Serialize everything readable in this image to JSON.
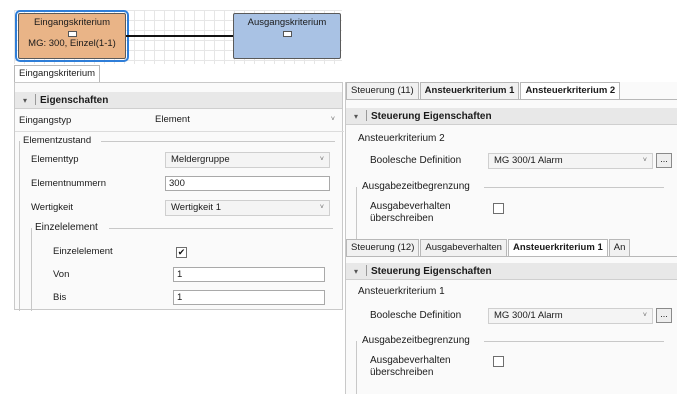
{
  "diagram": {
    "input_node": {
      "title": "Eingangskriterium",
      "subtitle": "MG: 300, Einzel(1-1)"
    },
    "output_node": {
      "title": "Ausgangskriterium"
    }
  },
  "left_panel": {
    "tab_label": "Eingangskriterium",
    "section_title": "Eigenschaften",
    "eingangstyp": {
      "label": "Eingangstyp",
      "value": "Element"
    },
    "elementzustand": {
      "group_label": "Elementzustand",
      "elementtyp": {
        "label": "Elementtyp",
        "value": "Meldergruppe"
      },
      "elementnummer": {
        "label": "Elementnummern",
        "value": "300"
      },
      "wertigkeit": {
        "label": "Wertigkeit",
        "value": "Wertigkeit 1"
      }
    },
    "einzelelement": {
      "group_label": "Einzelelement",
      "checkbox_label": "Einzelelement",
      "checked": true,
      "check_glyph": "✔",
      "von": {
        "label": "Von",
        "value": "1"
      },
      "bis": {
        "label": "Bis",
        "value": "1"
      }
    }
  },
  "right_top": {
    "tabs": [
      "Steuerung (11)",
      "Ansteuerkriterium 1",
      "Ansteuerkriterium 2"
    ],
    "active_tab_index": 2,
    "section_title": "Steuerung Eigenschaften",
    "subheading": "Ansteuerkriterium 2",
    "bool_label": "Boolesche Definition",
    "bool_value": "MG 300/1 Alarm",
    "dots_label": "...",
    "ausgabe_group": "Ausgabezeitbegrenzung",
    "override_line1": "Ausgabeverhalten",
    "override_line2": "überschreiben"
  },
  "right_bottom": {
    "tabs": [
      "Steuerung (12)",
      "Ausgabeverhalten",
      "Ansteuerkriterium 1",
      "An"
    ],
    "active_tab_index": 2,
    "section_title": "Steuerung Eigenschaften",
    "subheading": "Ansteuerkriterium 1",
    "bool_label": "Boolesche Definition",
    "bool_value": "MG 300/1 Alarm",
    "dots_label": "...",
    "ausgabe_group": "Ausgabezeitbegrenzung",
    "override_line1": "Ausgabeverhalten",
    "override_line2": "überschreiben"
  },
  "icons": {
    "collapse": "▾",
    "dropdown": "˅"
  },
  "colors": {
    "input_node": "#e9b487",
    "output_node": "#a9c2e4",
    "selection": "#2f7ed8"
  }
}
